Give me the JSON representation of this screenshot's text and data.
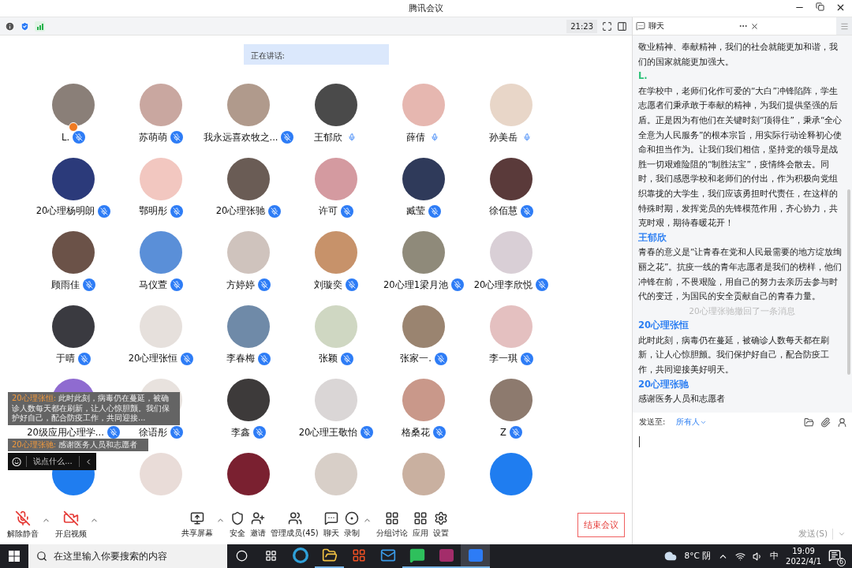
{
  "window": {
    "title": "腾讯会议"
  },
  "top_bar": {
    "time": "21:23"
  },
  "speaking": {
    "label": "正在讲话:"
  },
  "participants": [
    {
      "kind": "named",
      "name": "L.",
      "muted": true,
      "host": true
    },
    {
      "kind": "named",
      "name": "苏萌萌",
      "muted": true
    },
    {
      "kind": "named",
      "name": "我永远喜欢牧之...",
      "muted": true
    },
    {
      "kind": "named",
      "name": "王郁欣",
      "muted": false
    },
    {
      "kind": "named",
      "name": "薛倩",
      "muted": false
    },
    {
      "kind": "named",
      "name": "孙美岳",
      "muted": false
    },
    {
      "kind": "named",
      "name": "20心理杨明朗",
      "muted": true
    },
    {
      "kind": "named",
      "name": "鄂明彤",
      "muted": true
    },
    {
      "kind": "named",
      "name": "20心理张驰",
      "muted": true
    },
    {
      "kind": "named",
      "name": "许可",
      "muted": true
    },
    {
      "kind": "named",
      "name": "臧莹",
      "muted": true
    },
    {
      "kind": "named",
      "name": "徐佰慧",
      "muted": true
    },
    {
      "kind": "named",
      "name": "顾雨佳",
      "muted": true
    },
    {
      "kind": "named",
      "name": "马仪萱",
      "muted": true
    },
    {
      "kind": "named",
      "name": "方婷婷",
      "muted": true
    },
    {
      "kind": "named",
      "name": "刘璇奕",
      "muted": true
    },
    {
      "kind": "named",
      "name": "20心理1梁月池",
      "muted": true
    },
    {
      "kind": "named",
      "name": "20心理李欣悦",
      "muted": true
    },
    {
      "kind": "named",
      "name": "于晴",
      "muted": true
    },
    {
      "kind": "named",
      "name": "20心理张恒",
      "muted": true
    },
    {
      "kind": "named",
      "name": "李春梅",
      "muted": true
    },
    {
      "kind": "named",
      "name": "张颖",
      "muted": true
    },
    {
      "kind": "named",
      "name": "张家一.",
      "muted": true
    },
    {
      "kind": "named",
      "name": "李一琪",
      "muted": true
    },
    {
      "kind": "named",
      "name": "20级应用心理学...",
      "muted": true
    },
    {
      "kind": "named",
      "name": "徐语彤",
      "muted": true
    },
    {
      "kind": "named",
      "name": "李鑫",
      "muted": true
    },
    {
      "kind": "named",
      "name": "20心理王敬怡",
      "muted": true
    },
    {
      "kind": "named",
      "name": "格桑花",
      "muted": true
    },
    {
      "kind": "named",
      "name": "Z",
      "muted": true
    },
    {
      "kind": "cut"
    },
    {
      "kind": "cut"
    },
    {
      "kind": "cut"
    },
    {
      "kind": "cut"
    },
    {
      "kind": "cut"
    },
    {
      "kind": "cut"
    }
  ],
  "chat_popups": [
    {
      "sender": "20心理张恒:",
      "text": "此时此刻，病毒仍在蔓延，被确诊人数每天都在刷新，让人心惊胆颤。我们保护好自己，配合防疫工作，共同迎接..."
    },
    {
      "sender": "20心理张驰:",
      "text": "感谢医务人员和志愿者"
    }
  ],
  "quick_input": {
    "placeholder": "说点什么..."
  },
  "toolbar": [
    {
      "kind": "mic",
      "label": "解除静音",
      "off": true,
      "has_menu": true
    },
    {
      "kind": "video",
      "label": "开启视频",
      "off": true,
      "has_menu": true
    },
    {
      "kind": "share",
      "label": "共享屏幕",
      "has_menu": true
    },
    {
      "kind": "security",
      "label": "安全"
    },
    {
      "kind": "invite",
      "label": "邀请"
    },
    {
      "kind": "members",
      "label": "管理成员(45)"
    },
    {
      "kind": "chat",
      "label": "聊天"
    },
    {
      "kind": "record",
      "label": "录制",
      "has_menu": true
    },
    {
      "kind": "breakout",
      "label": "分组讨论"
    },
    {
      "kind": "apps",
      "label": "应用"
    },
    {
      "kind": "settings",
      "label": "设置"
    }
  ],
  "end_button": "结束会议",
  "chat": {
    "title": "聊天",
    "messages": [
      {
        "kind": "text",
        "text": "敬业精神、奉献精神，我们的社会就能更加和谐，我们的国家就能更加强大。"
      },
      {
        "kind": "sender",
        "text": "L.",
        "color": "#2fc27a"
      },
      {
        "kind": "text",
        "text": "在学校中，老师们化作可爱的“大白”冲锋陷阵，学生志愿者们秉承敢于奉献的精神，为我们提供坚强的后盾。正是因为有他们在关键时刻“顶得住”，秉承“全心全意为人民服务”的根本宗旨，用实际行动诠释初心使命和担当作为。让我们我们相信，坚持党的领导是战胜一切艰难险阻的“制胜法宝”，疫情终会散去。同时，我们感恩学校和老师们的付出，作为积极向党组织靠拢的大学生，我们应该勇担时代责任，在这样的特殊时期，发挥党员的先锋模范作用，齐心协力，共克时艰，期待春暖花开！"
      },
      {
        "kind": "sender",
        "text": "王郁欣",
        "color": "#2b7ef2"
      },
      {
        "kind": "text",
        "text": "青春的意义是“让青春在党和人民最需要的地方绽放绚丽之花”。抗疫一线的青年志愿者是我们的榜样，他们冲锋在前，不畏艰险，用自己的努力去亲历去参与时代的变迁，为国民的安全贡献自己的青春力量。"
      },
      {
        "kind": "notice",
        "text": "20心理张驰撤回了一条消息"
      },
      {
        "kind": "sender",
        "text": "20心理张恒",
        "color": "#2b7ef2"
      },
      {
        "kind": "text",
        "text": "此时此刻，病毒仍在蔓延，被确诊人数每天都在刷新，让人心惊胆颤。我们保护好自己，配合防疫工作，共同迎接美好明天。"
      },
      {
        "kind": "sender",
        "text": "20心理张驰",
        "color": "#2b7ef2"
      },
      {
        "kind": "text",
        "text": "感谢医务人员和志愿者"
      }
    ],
    "send_to_label": "发送至:",
    "send_to_value": "所有人",
    "send_button": "发送(S)"
  },
  "taskbar": {
    "search_placeholder": "在这里输入你要搜索的内容",
    "apps": [
      {
        "kind": "edge",
        "running": false,
        "selected": false
      },
      {
        "kind": "folder",
        "running": true,
        "selected": false
      },
      {
        "kind": "store",
        "running": false,
        "selected": false
      },
      {
        "kind": "mail",
        "running": false,
        "selected": false
      },
      {
        "kind": "wechat",
        "running": true,
        "selected": false
      },
      {
        "kind": "archive",
        "running": true,
        "selected": false
      },
      {
        "kind": "meeting",
        "running": true,
        "selected": true
      }
    ],
    "weather": "8°C 阴",
    "ime": "中",
    "time": "19:09",
    "date": "2022/4/1",
    "notifications": "6"
  }
}
